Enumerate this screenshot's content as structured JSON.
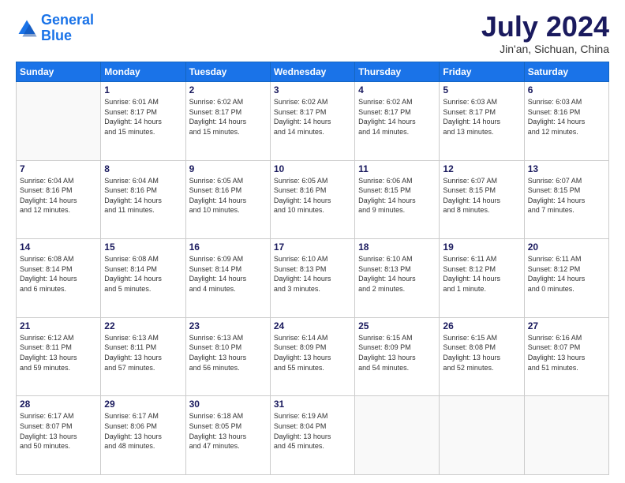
{
  "logo": {
    "line1": "General",
    "line2": "Blue"
  },
  "title": "July 2024",
  "location": "Jin'an, Sichuan, China",
  "days_of_week": [
    "Sunday",
    "Monday",
    "Tuesday",
    "Wednesday",
    "Thursday",
    "Friday",
    "Saturday"
  ],
  "weeks": [
    [
      {
        "day": "",
        "info": ""
      },
      {
        "day": "1",
        "info": "Sunrise: 6:01 AM\nSunset: 8:17 PM\nDaylight: 14 hours\nand 15 minutes."
      },
      {
        "day": "2",
        "info": "Sunrise: 6:02 AM\nSunset: 8:17 PM\nDaylight: 14 hours\nand 15 minutes."
      },
      {
        "day": "3",
        "info": "Sunrise: 6:02 AM\nSunset: 8:17 PM\nDaylight: 14 hours\nand 14 minutes."
      },
      {
        "day": "4",
        "info": "Sunrise: 6:02 AM\nSunset: 8:17 PM\nDaylight: 14 hours\nand 14 minutes."
      },
      {
        "day": "5",
        "info": "Sunrise: 6:03 AM\nSunset: 8:17 PM\nDaylight: 14 hours\nand 13 minutes."
      },
      {
        "day": "6",
        "info": "Sunrise: 6:03 AM\nSunset: 8:16 PM\nDaylight: 14 hours\nand 12 minutes."
      }
    ],
    [
      {
        "day": "7",
        "info": "Sunrise: 6:04 AM\nSunset: 8:16 PM\nDaylight: 14 hours\nand 12 minutes."
      },
      {
        "day": "8",
        "info": "Sunrise: 6:04 AM\nSunset: 8:16 PM\nDaylight: 14 hours\nand 11 minutes."
      },
      {
        "day": "9",
        "info": "Sunrise: 6:05 AM\nSunset: 8:16 PM\nDaylight: 14 hours\nand 10 minutes."
      },
      {
        "day": "10",
        "info": "Sunrise: 6:05 AM\nSunset: 8:16 PM\nDaylight: 14 hours\nand 10 minutes."
      },
      {
        "day": "11",
        "info": "Sunrise: 6:06 AM\nSunset: 8:15 PM\nDaylight: 14 hours\nand 9 minutes."
      },
      {
        "day": "12",
        "info": "Sunrise: 6:07 AM\nSunset: 8:15 PM\nDaylight: 14 hours\nand 8 minutes."
      },
      {
        "day": "13",
        "info": "Sunrise: 6:07 AM\nSunset: 8:15 PM\nDaylight: 14 hours\nand 7 minutes."
      }
    ],
    [
      {
        "day": "14",
        "info": "Sunrise: 6:08 AM\nSunset: 8:14 PM\nDaylight: 14 hours\nand 6 minutes."
      },
      {
        "day": "15",
        "info": "Sunrise: 6:08 AM\nSunset: 8:14 PM\nDaylight: 14 hours\nand 5 minutes."
      },
      {
        "day": "16",
        "info": "Sunrise: 6:09 AM\nSunset: 8:14 PM\nDaylight: 14 hours\nand 4 minutes."
      },
      {
        "day": "17",
        "info": "Sunrise: 6:10 AM\nSunset: 8:13 PM\nDaylight: 14 hours\nand 3 minutes."
      },
      {
        "day": "18",
        "info": "Sunrise: 6:10 AM\nSunset: 8:13 PM\nDaylight: 14 hours\nand 2 minutes."
      },
      {
        "day": "19",
        "info": "Sunrise: 6:11 AM\nSunset: 8:12 PM\nDaylight: 14 hours\nand 1 minute."
      },
      {
        "day": "20",
        "info": "Sunrise: 6:11 AM\nSunset: 8:12 PM\nDaylight: 14 hours\nand 0 minutes."
      }
    ],
    [
      {
        "day": "21",
        "info": "Sunrise: 6:12 AM\nSunset: 8:11 PM\nDaylight: 13 hours\nand 59 minutes."
      },
      {
        "day": "22",
        "info": "Sunrise: 6:13 AM\nSunset: 8:11 PM\nDaylight: 13 hours\nand 57 minutes."
      },
      {
        "day": "23",
        "info": "Sunrise: 6:13 AM\nSunset: 8:10 PM\nDaylight: 13 hours\nand 56 minutes."
      },
      {
        "day": "24",
        "info": "Sunrise: 6:14 AM\nSunset: 8:09 PM\nDaylight: 13 hours\nand 55 minutes."
      },
      {
        "day": "25",
        "info": "Sunrise: 6:15 AM\nSunset: 8:09 PM\nDaylight: 13 hours\nand 54 minutes."
      },
      {
        "day": "26",
        "info": "Sunrise: 6:15 AM\nSunset: 8:08 PM\nDaylight: 13 hours\nand 52 minutes."
      },
      {
        "day": "27",
        "info": "Sunrise: 6:16 AM\nSunset: 8:07 PM\nDaylight: 13 hours\nand 51 minutes."
      }
    ],
    [
      {
        "day": "28",
        "info": "Sunrise: 6:17 AM\nSunset: 8:07 PM\nDaylight: 13 hours\nand 50 minutes."
      },
      {
        "day": "29",
        "info": "Sunrise: 6:17 AM\nSunset: 8:06 PM\nDaylight: 13 hours\nand 48 minutes."
      },
      {
        "day": "30",
        "info": "Sunrise: 6:18 AM\nSunset: 8:05 PM\nDaylight: 13 hours\nand 47 minutes."
      },
      {
        "day": "31",
        "info": "Sunrise: 6:19 AM\nSunset: 8:04 PM\nDaylight: 13 hours\nand 45 minutes."
      },
      {
        "day": "",
        "info": ""
      },
      {
        "day": "",
        "info": ""
      },
      {
        "day": "",
        "info": ""
      }
    ]
  ]
}
